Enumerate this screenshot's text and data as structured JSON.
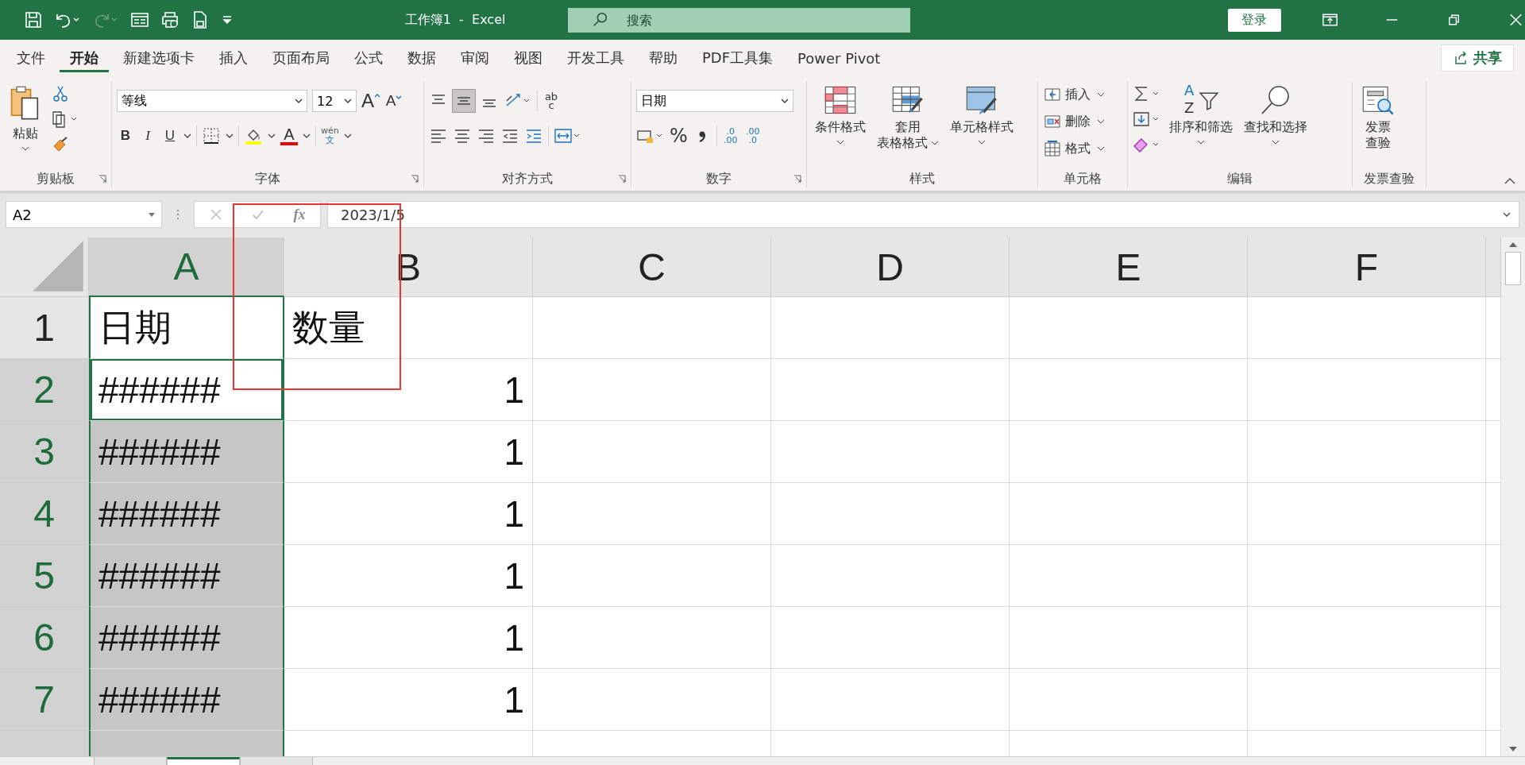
{
  "title_bar": {
    "title": "工作簿1  -  Excel",
    "search_placeholder": "搜索",
    "sign_in": "登录"
  },
  "menu_tabs": [
    {
      "label": "文件",
      "selected": false
    },
    {
      "label": "开始",
      "selected": true
    },
    {
      "label": "新建选项卡",
      "selected": false
    },
    {
      "label": "插入",
      "selected": false
    },
    {
      "label": "页面布局",
      "selected": false
    },
    {
      "label": "公式",
      "selected": false
    },
    {
      "label": "数据",
      "selected": false
    },
    {
      "label": "审阅",
      "selected": false
    },
    {
      "label": "视图",
      "selected": false
    },
    {
      "label": "开发工具",
      "selected": false
    },
    {
      "label": "帮助",
      "selected": false
    },
    {
      "label": "PDF工具集",
      "selected": false
    },
    {
      "label": "Power Pivot",
      "selected": false
    }
  ],
  "share_button": "共享",
  "ribbon": {
    "clipboard": {
      "label": "剪贴板",
      "paste": "粘贴"
    },
    "font": {
      "label": "字体",
      "family": "等线",
      "size": "12",
      "grow": "A",
      "shrink": "A",
      "bold": "B",
      "italic": "I",
      "underline": "U",
      "font_color": "A",
      "phonetic_top": "wén",
      "phonetic_bottom": "文"
    },
    "alignment": {
      "label": "对齐方式",
      "wrap_top": "ab",
      "wrap_bottom": "c"
    },
    "number": {
      "label": "数字",
      "format": "日期",
      "percent": "%",
      "add_decimal": [
        ".0",
        ".00"
      ],
      "remove_decimal": [
        ".00",
        ".0"
      ]
    },
    "styles": {
      "label": "样式",
      "conditional": "条件格式",
      "table_top": "套用",
      "table_bottom": "表格格式",
      "cell_styles": "单元格样式"
    },
    "cells": {
      "label": "单元格",
      "insert": "插入",
      "delete": "删除",
      "format": "格式"
    },
    "editing": {
      "label": "编辑",
      "sort_letters": [
        "A",
        "Z"
      ],
      "sort": "排序和筛选",
      "find": "查找和选择"
    },
    "invoice": {
      "label": "发票查验",
      "top": "发票",
      "bottom": "查验"
    }
  },
  "formula_bar": {
    "name_box": "A2",
    "fx": "fx",
    "formula": "2023/1/5"
  },
  "columns": [
    {
      "label": "A",
      "selected": true
    },
    {
      "label": "B",
      "selected": false
    },
    {
      "label": "C",
      "selected": false
    },
    {
      "label": "D",
      "selected": false
    },
    {
      "label": "E",
      "selected": false
    },
    {
      "label": "F",
      "selected": false
    }
  ],
  "rows": [
    {
      "number": "1",
      "selected": false,
      "cells": [
        {
          "value": "日期",
          "kind": "text",
          "selected": false,
          "active": false
        },
        {
          "value": "数量",
          "kind": "text",
          "selected": false,
          "active": false
        }
      ]
    },
    {
      "number": "2",
      "selected": true,
      "cells": [
        {
          "value": "######",
          "kind": "text",
          "selected": true,
          "active": true
        },
        {
          "value": "1",
          "kind": "number",
          "selected": false,
          "active": false
        }
      ]
    },
    {
      "number": "3",
      "selected": true,
      "cells": [
        {
          "value": "######",
          "kind": "text",
          "selected": true,
          "active": false
        },
        {
          "value": "1",
          "kind": "number",
          "selected": false,
          "active": false
        }
      ]
    },
    {
      "number": "4",
      "selected": true,
      "cells": [
        {
          "value": "######",
          "kind": "text",
          "selected": true,
          "active": false
        },
        {
          "value": "1",
          "kind": "number",
          "selected": false,
          "active": false
        }
      ]
    },
    {
      "number": "5",
      "selected": true,
      "cells": [
        {
          "value": "######",
          "kind": "text",
          "selected": true,
          "active": false
        },
        {
          "value": "1",
          "kind": "number",
          "selected": false,
          "active": false
        }
      ]
    },
    {
      "number": "6",
      "selected": true,
      "cells": [
        {
          "value": "######",
          "kind": "text",
          "selected": true,
          "active": false
        },
        {
          "value": "1",
          "kind": "number",
          "selected": false,
          "active": false
        }
      ]
    },
    {
      "number": "7",
      "selected": true,
      "cells": [
        {
          "value": "######",
          "kind": "text",
          "selected": true,
          "active": false
        },
        {
          "value": "1",
          "kind": "number",
          "selected": false,
          "active": false
        }
      ]
    }
  ],
  "sheet_tabs": [
    {
      "selected": false
    },
    {
      "selected": true
    },
    {
      "selected": false
    }
  ],
  "annotation": {
    "kind": "box"
  }
}
